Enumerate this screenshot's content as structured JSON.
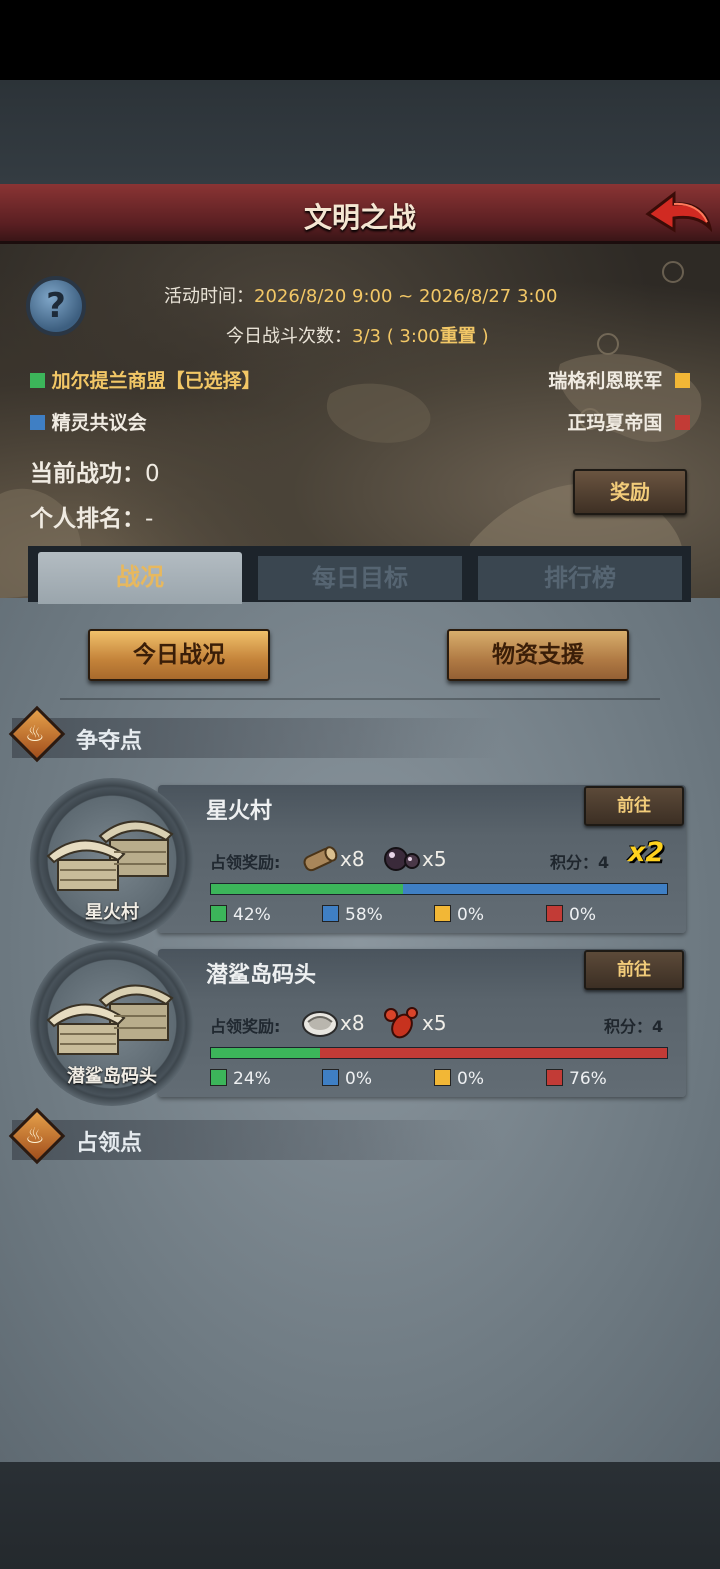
{
  "header": {
    "title": "文明之战"
  },
  "event": {
    "time_label": "活动时间：",
    "time_value": "2026/8/20 9:00 ~ 2026/8/27 3:00",
    "battles_label": "今日战斗次数：",
    "battles_value": "3/3 ( 3:00",
    "battles_reset": "重置",
    "battles_close": " )"
  },
  "factions": [
    {
      "name": "加尔提兰商盟【已选择】",
      "color": "#3cb55a",
      "selected": true
    },
    {
      "name": "瑞格利恩联军",
      "color": "#f2b736"
    },
    {
      "name": "精灵共议会",
      "color": "#3f7fc4"
    },
    {
      "name": "正玛夏帝国",
      "color": "#c23b36"
    }
  ],
  "stats": {
    "merit_label": "当前战功：",
    "merit_value": "0",
    "rank_label": "个人排名：",
    "rank_value": "-"
  },
  "reward_button": "奖励",
  "tabs": [
    {
      "label": "战况",
      "active": true
    },
    {
      "label": "每日目标",
      "active": false
    },
    {
      "label": "排行榜",
      "active": false
    }
  ],
  "sub_buttons": {
    "today": "今日战况",
    "support": "物资支援"
  },
  "sections": {
    "contest": "争夺点",
    "occupied": "占领点"
  },
  "points": [
    {
      "name": "星火村",
      "goto": "前往",
      "reward_label": "占领奖励:",
      "rewards": [
        {
          "icon": "wood-log-icon",
          "qty": "x8"
        },
        {
          "icon": "dark-orb-icon",
          "qty": "x5"
        }
      ],
      "score_label": "积分：",
      "score": "4",
      "multiplier": "x2",
      "shares": [
        42,
        58,
        0,
        0
      ],
      "share_labels": [
        "42%",
        "58%",
        "0%",
        "0%"
      ]
    },
    {
      "name": "潜鲨岛码头",
      "goto": "前往",
      "reward_label": "占领奖励:",
      "rewards": [
        {
          "icon": "oyster-icon",
          "qty": "x8"
        },
        {
          "icon": "lobster-icon",
          "qty": "x5"
        }
      ],
      "score_label": "积分：",
      "score": "4",
      "multiplier": "",
      "shares": [
        24,
        0,
        0,
        76
      ],
      "share_labels": [
        "24%",
        "0%",
        "0%",
        "76%"
      ]
    }
  ],
  "colors": {
    "green": "#3cb55a",
    "blue": "#3f7fc4",
    "yellow": "#f2b736",
    "red": "#c23b36"
  }
}
